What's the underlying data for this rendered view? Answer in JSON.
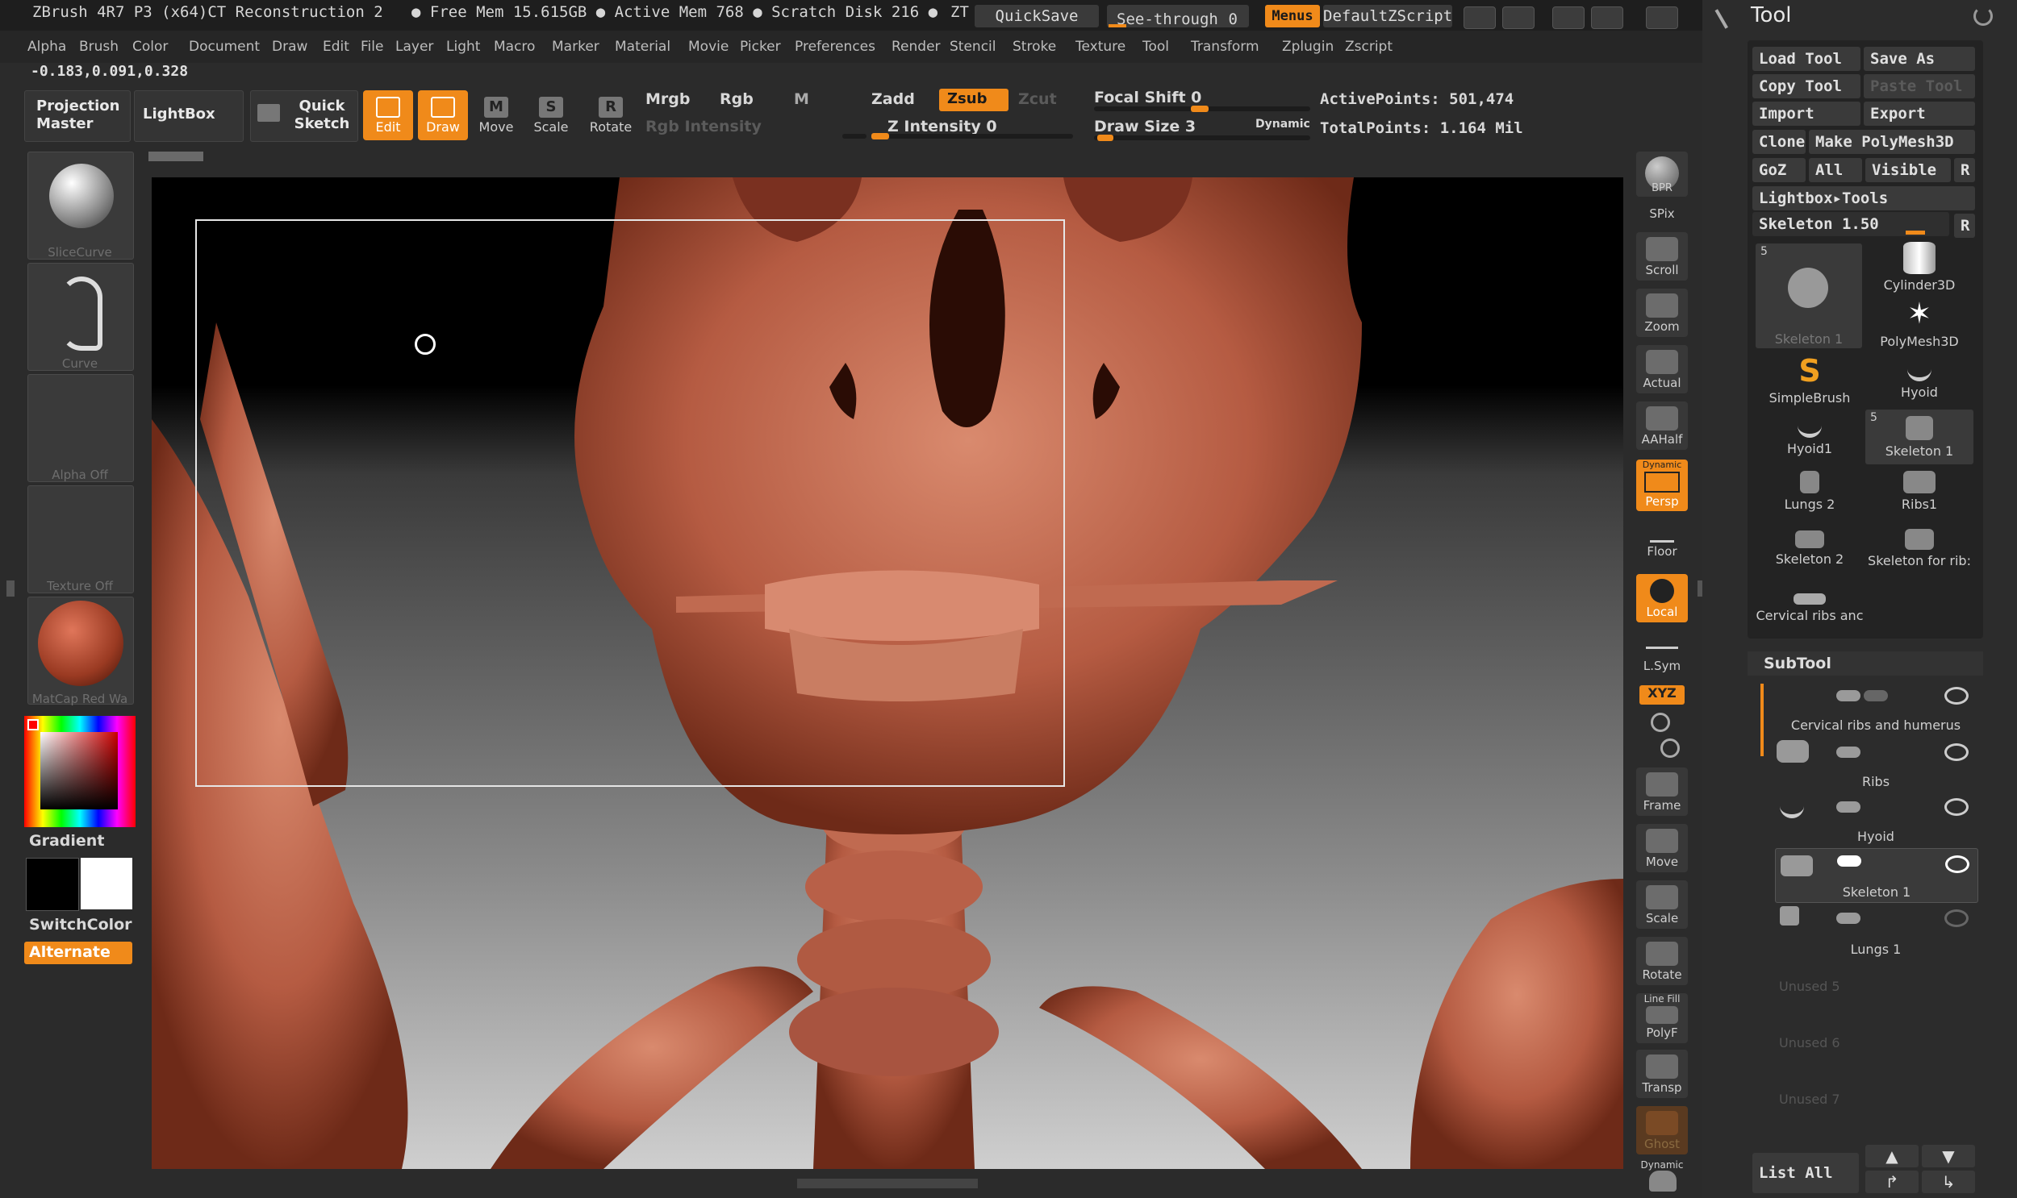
{
  "titlebar": {
    "title": "ZBrush 4R7 P3 (x64)CT Reconstruction 2",
    "free_mem": "● Free Mem 15.615GB ● Active Mem 768 ● Scratch Disk 216 ●",
    "zt": "ZT",
    "quicksave": "QuickSave",
    "seethrough": "See-through",
    "seethrough_val": "0",
    "menus": "Menus",
    "defaultzscript": "DefaultZScript"
  },
  "menus": [
    "Alpha",
    "Brush",
    "Color",
    "Document",
    "Draw",
    "Edit",
    "File",
    "Layer",
    "Light",
    "Macro",
    "Marker",
    "Material",
    "Movie",
    "Picker",
    "Preferences",
    "Render",
    "Stencil",
    "Stroke",
    "Texture",
    "Tool",
    "Transform",
    "Zplugin",
    "Zscript"
  ],
  "coords": "-0.183,0.091,0.328",
  "toolbar": {
    "projection_master": "Projection Master",
    "lightbox": "LightBox",
    "quick_sketch": "Quick Sketch",
    "edit": "Edit",
    "draw": "Draw",
    "move": "Move",
    "scale": "Scale",
    "rotate": "Rotate",
    "mrgb": "Mrgb",
    "rgb": "Rgb",
    "m": "M",
    "zadd": "Zadd",
    "zsub": "Zsub",
    "zcut": "Zcut",
    "rgb_intensity": "Rgb Intensity",
    "z_intensity": "Z Intensity 0",
    "focal_shift": "Focal Shift 0",
    "draw_size": "Draw Size 3",
    "dynamic": "Dynamic",
    "active_points": "ActivePoints: 501,474",
    "total_points": "TotalPoints: 1.164 Mil"
  },
  "left": {
    "slicecurve": "SliceCurve",
    "curve": "Curve",
    "alpha": "Alpha Off",
    "texture": "Texture Off",
    "matcap": "MatCap Red Wa",
    "gradient": "Gradient",
    "switchcolor": "SwitchColor",
    "alternate": "Alternate"
  },
  "shelf": {
    "bpr": "BPR",
    "spix": "SPix",
    "scroll": "Scroll",
    "zoom": "Zoom",
    "actual": "Actual",
    "aahalf": "AAHalf",
    "dynamic": "Dynamic",
    "persp": "Persp",
    "floor": "Floor",
    "local": "Local",
    "lsym": "L.Sym",
    "xyz": "XYZ",
    "frame": "Frame",
    "move": "Move",
    "scale": "Scale",
    "rotate": "Rotate",
    "linefill": "Line Fill",
    "polyf": "PolyF",
    "transp": "Transp",
    "ghost": "Ghost",
    "solo": "Dynamic"
  },
  "tool": {
    "title": "Tool",
    "load_tool": "Load Tool",
    "save_as": "Save As",
    "copy_tool": "Copy Tool",
    "paste_tool": "Paste Tool",
    "import": "Import",
    "export": "Export",
    "clone": "Clone",
    "make_polymesh": "Make PolyMesh3D",
    "goz": "GoZ",
    "all": "All",
    "visible": "Visible",
    "r": "R",
    "lightbox_tools": "Lightbox▸Tools",
    "skeleton_slider": "Skeleton 1.50",
    "r2": "R",
    "cells": [
      {
        "name": "Skeleton 1",
        "badge": "5"
      },
      {
        "name": "Cylinder3D"
      },
      {
        "name": "PolyMesh3D"
      },
      {
        "name": "SimpleBrush"
      },
      {
        "name": "Hyoid"
      },
      {
        "name": "Hyoid1"
      },
      {
        "name": "Skeleton 1",
        "badge": "5"
      },
      {
        "name": "Lungs 2"
      },
      {
        "name": "Ribs1"
      },
      {
        "name": "Skeleton 2"
      },
      {
        "name": "Skeleton for rib:"
      },
      {
        "name": "Cervical ribs anc"
      }
    ]
  },
  "subtool": {
    "title": "SubTool",
    "items": [
      "Cervical ribs and humerus",
      "Ribs",
      "Hyoid",
      "Skeleton 1",
      "Lungs 1"
    ],
    "unused": [
      "Unused 5",
      "Unused 6",
      "Unused 7"
    ],
    "list_all": "List All"
  }
}
